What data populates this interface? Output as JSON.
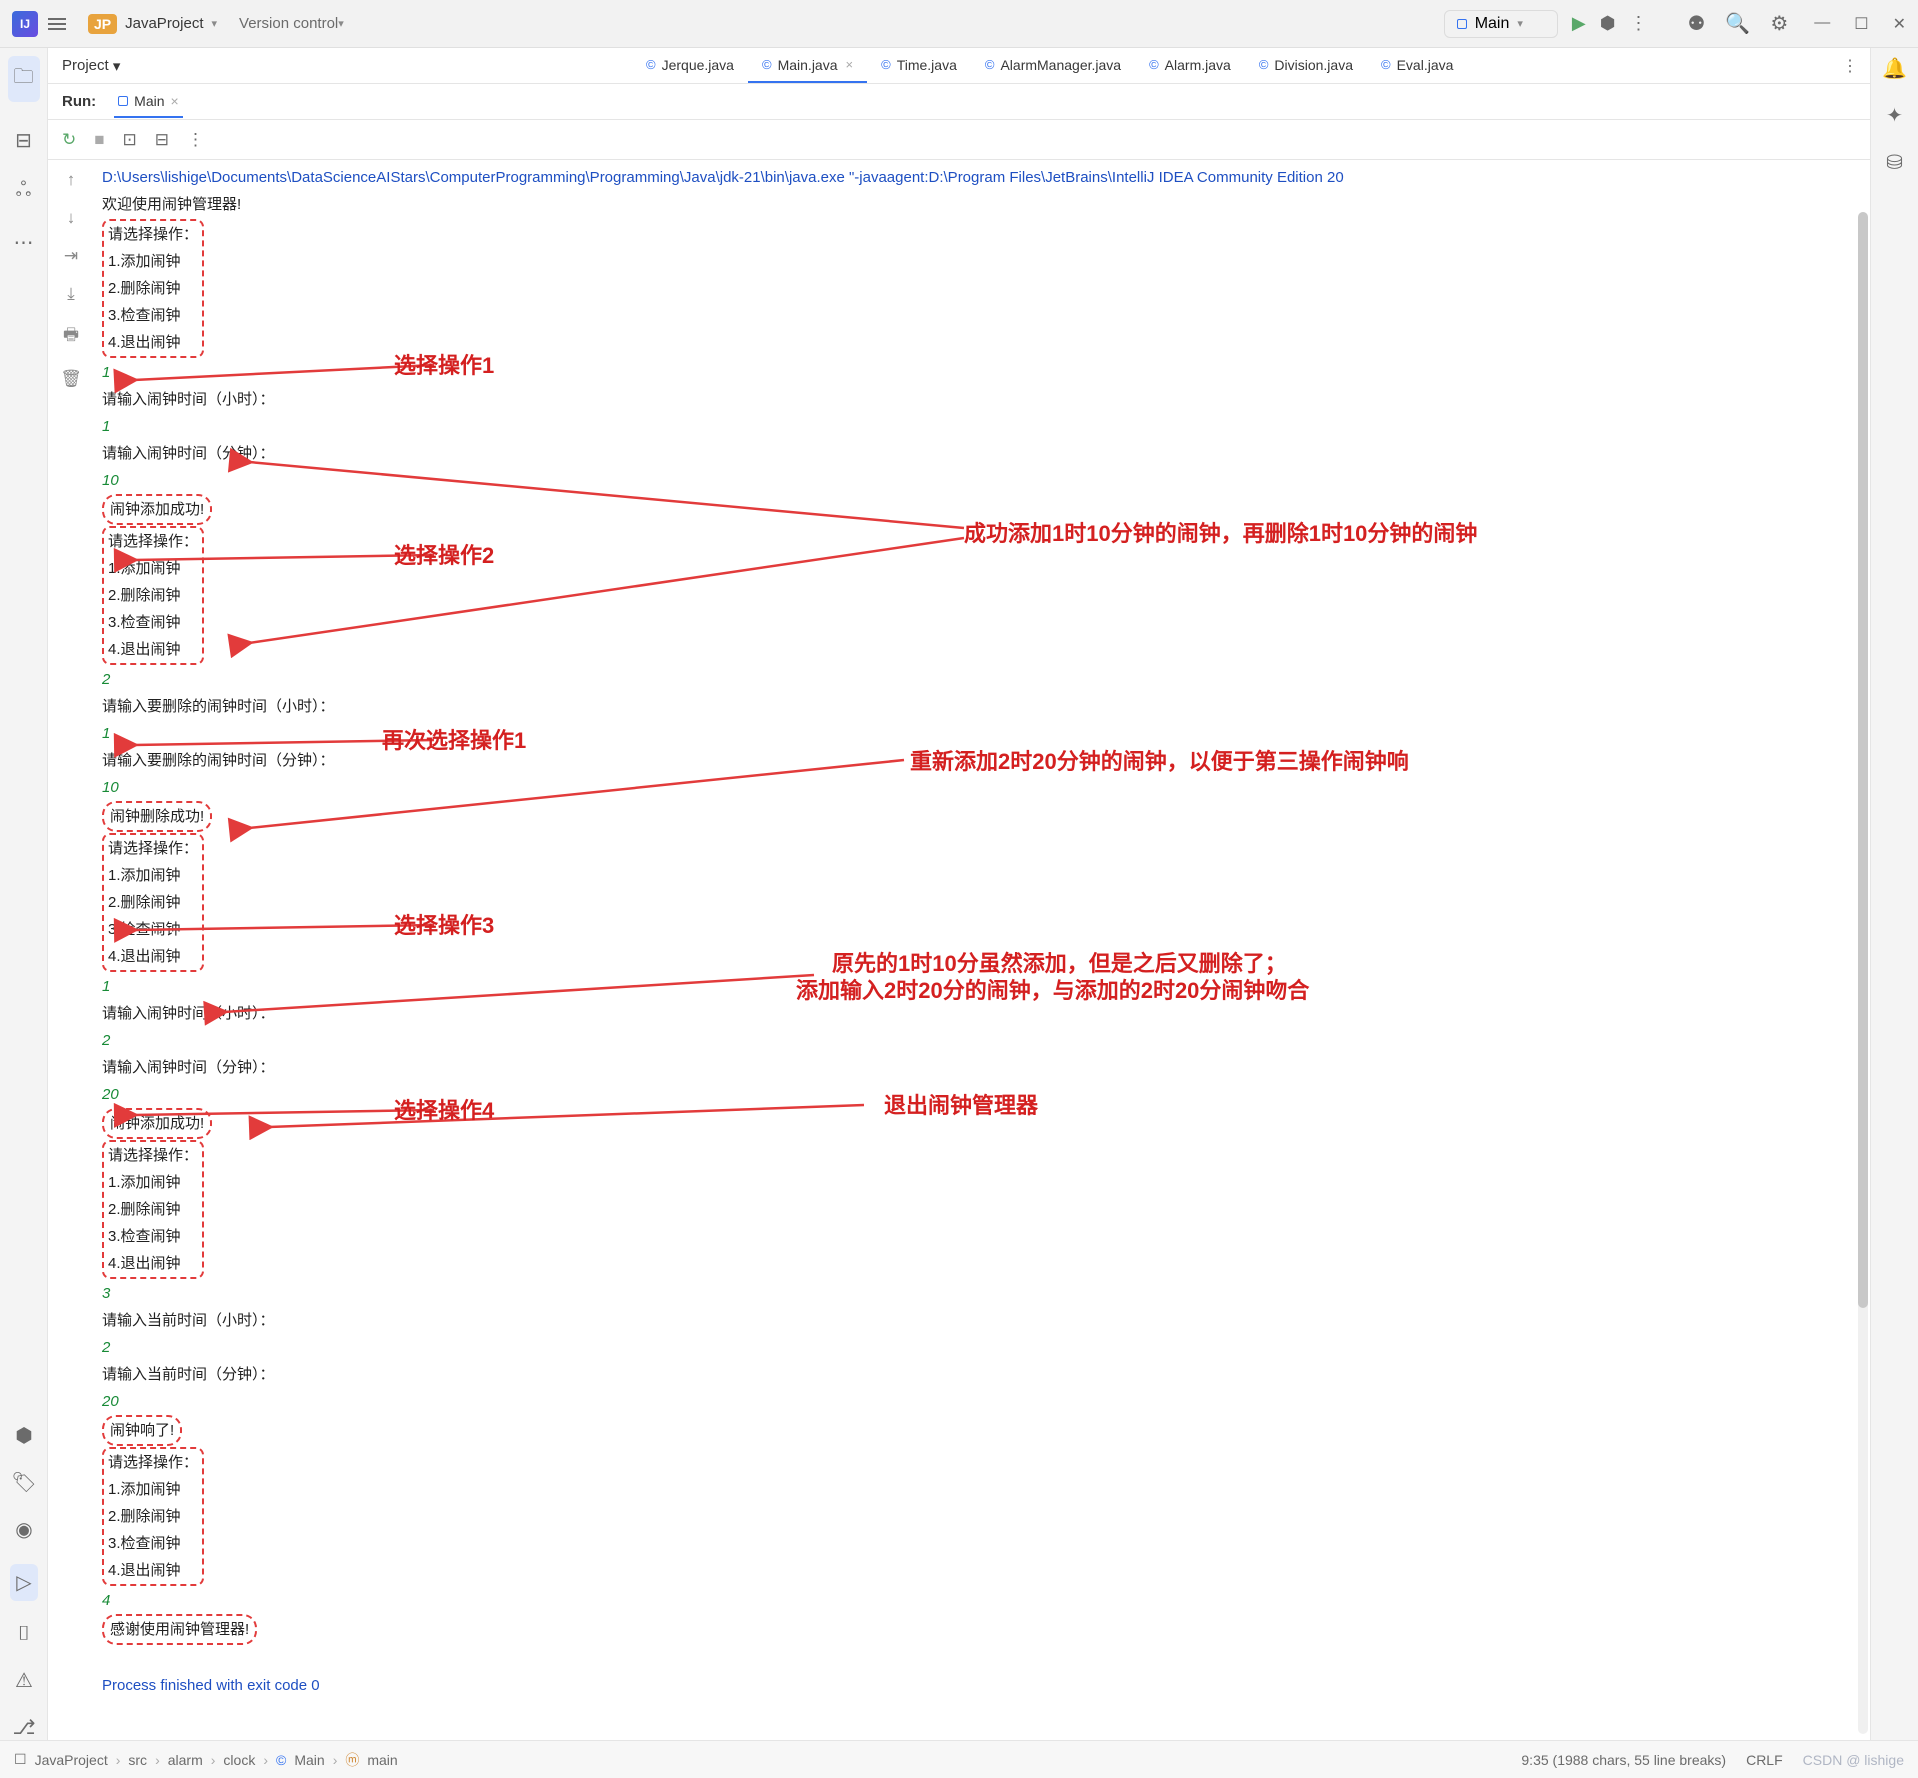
{
  "topbar": {
    "logo": "IJ",
    "project_badge": "JP",
    "project_name": "JavaProject",
    "vcs": "Version control",
    "runcfg": "Main"
  },
  "project_header": "Project",
  "tabs": [
    {
      "name": "Jerque.java",
      "active": false
    },
    {
      "name": "Main.java",
      "active": true
    },
    {
      "name": "Time.java",
      "active": false
    },
    {
      "name": "AlarmManager.java",
      "active": false
    },
    {
      "name": "Alarm.java",
      "active": false
    },
    {
      "name": "Division.java",
      "active": false
    },
    {
      "name": "Eval.java",
      "active": false
    }
  ],
  "run": {
    "label": "Run:",
    "tab": "Main"
  },
  "console": {
    "path": "D:\\Users\\lishige\\Documents\\DataScienceAIStars\\ComputerProgramming\\Programming\\Java\\jdk-21\\bin\\java.exe \"-javaagent:D:\\Program Files\\JetBrains\\IntelliJ IDEA Community Edition 20",
    "welcome": "欢迎使用闹钟管理器!",
    "menu_title": "请选择操作：",
    "menu": [
      "1.添加闹钟",
      "2.删除闹钟",
      "3.检查闹钟",
      "4.退出闹钟"
    ],
    "prompt_hour": "请输入闹钟时间（小时）：",
    "prompt_min": "请输入闹钟时间（分钟）：",
    "prompt_del_hour": "请输入要删除的闹钟时间（小时）：",
    "prompt_del_min": "请输入要删除的闹钟时间（分钟）：",
    "prompt_cur_hour": "请输入当前时间（小时）：",
    "prompt_cur_min": "请输入当前时间（分钟）：",
    "added_ok": "闹钟添加成功!",
    "deleted_ok": "闹钟删除成功!",
    "alarm_ring": "闹钟响了!",
    "thanks": "感谢使用闹钟管理器!",
    "exit": "Process finished with exit code 0",
    "v1": "1",
    "v10": "10",
    "v2": "2",
    "v20": "20",
    "v3": "3",
    "v4": "4"
  },
  "annotations": {
    "a1": "选择操作1",
    "a2": "选择操作2",
    "a3": "再次选择操作1",
    "a4": "选择操作3",
    "a5": "选择操作4",
    "b1": "成功添加1时10分钟的闹钟，再删除1时10分钟的闹钟",
    "b2": "重新添加2时20分钟的闹钟，以便于第三操作闹钟响",
    "b3a": "原先的1时10分虽然添加，但是之后又删除了；",
    "b3b": "添加输入2时20分的闹钟，与添加的2时20分闹钟吻合",
    "b4": "退出闹钟管理器"
  },
  "status": {
    "crumbs": [
      "JavaProject",
      "src",
      "alarm",
      "clock",
      "Main",
      "main"
    ],
    "pos": "9:35 (1988 chars, 55 line breaks)",
    "crlf": "CRLF",
    "watermark": "CSDN @ lishige"
  }
}
